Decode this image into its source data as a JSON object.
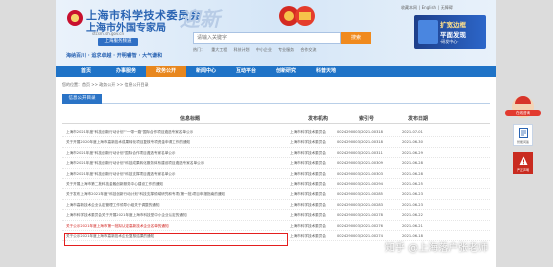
{
  "header": {
    "title": "上海市科学技术委员会",
    "subtitle": "上海市外国专家局",
    "url": "stcsm.sh.gov.cn",
    "city_tag": "上海服务频道",
    "slogan": "海纳百川 · 追求卓越 · 开明睿智 · 大气谦和",
    "brush_logo": "迎新",
    "top_links": [
      "收藏本网",
      "English",
      "无障碍"
    ]
  },
  "search": {
    "placeholder": "请输入关键字",
    "button_label": "搜索",
    "hot_words": [
      "热门：",
      "重大工程",
      "科技计划",
      "中小企业",
      "专业服务",
      "合作交流"
    ]
  },
  "promo": {
    "line1": "扩宽边框",
    "line2": "平面发现",
    "line3": "·研发中心·"
  },
  "nav": {
    "items": [
      "首页",
      "办事服务",
      "政务公开",
      "新闻中心",
      "互动平台",
      "创新研究",
      "科普天地"
    ],
    "active_index": 2
  },
  "breadcrumb": "您的位置：首页 >> 政务公开 >> 信息公开目录",
  "panel": {
    "title": "信息公开目录"
  },
  "table": {
    "headers": [
      "信息标题",
      "发布机构",
      "索引号",
      "发布日期"
    ],
    "rows": [
      {
        "title": "上海市2021年度\"科技创新行动计划\"\"一带一路\"国际合作项目遴选专家名单公示",
        "org": "上海市科学技术委员会",
        "idx": "0024290003/2021-00318",
        "date": "2021-07-01"
      },
      {
        "title": "关于开展2020年度上海市高新技术成果转化项目复核专项资金申请工作的通知",
        "org": "上海市科学技术委员会",
        "idx": "0024290003/2021-00318",
        "date": "2021-06-30"
      },
      {
        "title": "上海市2021年度\"科技创新行动计划\"国际合作项目遴选专家名单公示",
        "org": "上海市科学技术委员会",
        "idx": "0024290003/2021-00311",
        "date": "2021-06-29"
      },
      {
        "title": "上海市2021年度\"科技创新行动计划\"科技成果转化服务体系建设项目遴选专家名单公示",
        "org": "上海市科学技术委员会",
        "idx": "0024290003/2021-00309",
        "date": "2021-06-28"
      },
      {
        "title": "上海市2021年度\"科技创新行动计划\"科技支撑项目遴选专家名单公示",
        "org": "上海市科学技术委员会",
        "idx": "0024290003/2021-00303",
        "date": "2021-06-28"
      },
      {
        "title": "关于开展上海市第二批科技金融创新服务中心建设工作的通知",
        "org": "上海市科学技术委员会",
        "idx": "0024290003/2021-00294",
        "date": "2021-06-25"
      },
      {
        "title": "关于发布上海市2021年度\"科技创新行动计划\"科技支撑领域研究和专项(第一批)项目申报指南的通知",
        "org": "上海市科学技术委员会",
        "idx": "0024290003/2021-00285",
        "date": "2021-06-23"
      },
      {
        "title": "上海市高新技术企业认定管理工作领导小组关于调整的通知",
        "org": "上海市科学技术委员会",
        "idx": "0024290003/2021-00283",
        "date": "2021-06-23"
      },
      {
        "title": "上海市科学技术委员会关于开展2021年度上海市科技型中小企业认定的通知",
        "org": "上海市科学技术委员会",
        "idx": "0024290003/2021-00278",
        "date": "2021-06-22"
      },
      {
        "title": "关于公示2021年度上海市第一批拟认定高新技术企业名单的通知",
        "org": "上海市科学技术委员会",
        "idx": "0024290003/2021-00276",
        "date": "2021-06-21"
      },
      {
        "title": "关于公示2021年度上海市高新技术企业复核结果的通知",
        "org": "上海市科学技术委员会",
        "idx": "0024290003/2021-00274",
        "date": "2021-06-18"
      }
    ],
    "highlight_index": 9
  },
  "watermark": "知乎 @上海落户张老师",
  "floats": {
    "tag": "在线咨询",
    "widget1_label": "智能问答",
    "widget2_label": "严正声明"
  }
}
